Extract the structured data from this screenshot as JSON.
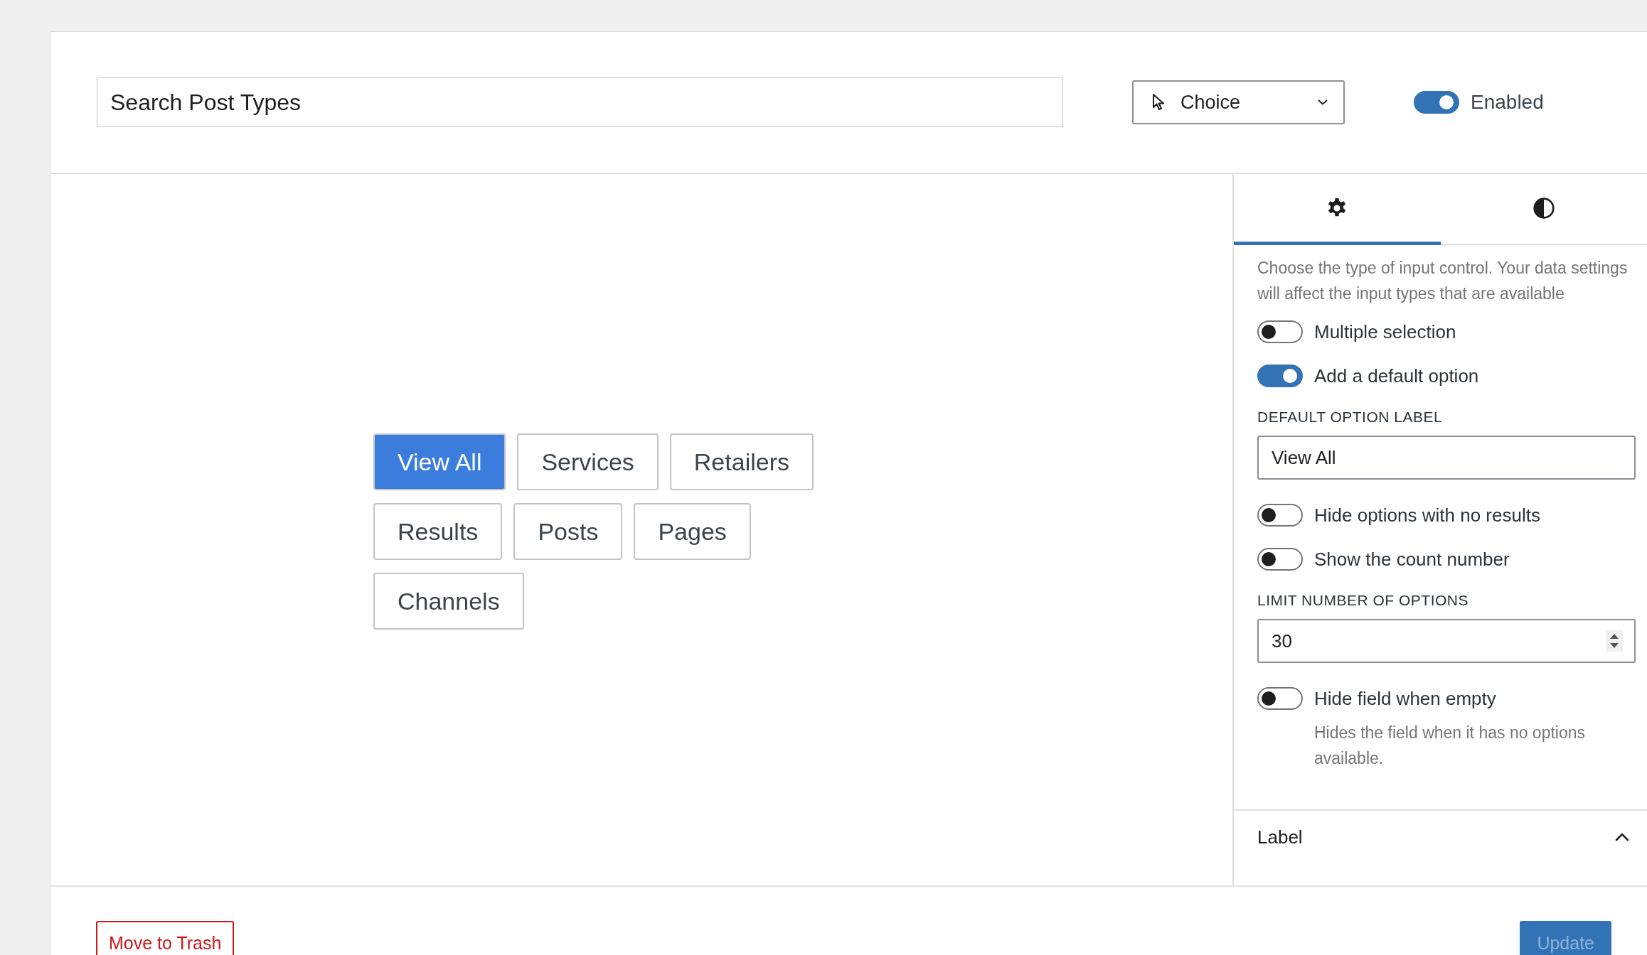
{
  "header": {
    "title_field": {
      "value": "Search Post Types"
    },
    "control_type": {
      "value": "Choice"
    },
    "enabled": {
      "label": "Enabled",
      "on": true
    }
  },
  "preview": {
    "options": [
      {
        "label": "View All",
        "selected": true
      },
      {
        "label": "Services",
        "selected": false
      },
      {
        "label": "Retailers",
        "selected": false
      },
      {
        "label": "Results",
        "selected": false
      },
      {
        "label": "Posts",
        "selected": false
      },
      {
        "label": "Pages",
        "selected": false
      },
      {
        "label": "Channels",
        "selected": false
      }
    ]
  },
  "sidebar": {
    "tabs": [
      {
        "kind": "settings",
        "selected": true
      },
      {
        "kind": "style",
        "selected": false
      }
    ],
    "description": "Choose the type of input control. Your data settings will affect the input types that are available",
    "settings": [
      {
        "kind": "toggle",
        "label": "Multiple selection",
        "on": false
      },
      {
        "kind": "toggle",
        "label": "Add a default option",
        "on": true
      },
      {
        "kind": "text",
        "label": "DEFAULT OPTION LABEL",
        "value": "View All"
      },
      {
        "kind": "toggle",
        "label": "Hide options with no results",
        "on": false
      },
      {
        "kind": "toggle",
        "label": "Show the count number",
        "on": false
      },
      {
        "kind": "number",
        "label": "LIMIT NUMBER OF OPTIONS",
        "value": "30"
      },
      {
        "kind": "toggle",
        "label": "Hide field when empty",
        "on": false,
        "help": "Hides the field when it has no options available."
      }
    ],
    "section": {
      "title": "Label",
      "expanded": true
    }
  },
  "footer": {
    "trash": "Move to Trash",
    "update": {
      "label": "Update",
      "disabled": true
    }
  }
}
